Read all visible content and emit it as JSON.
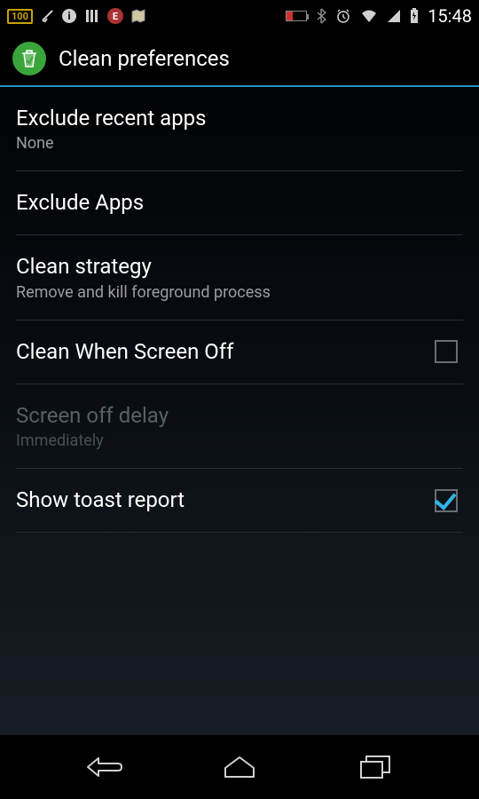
{
  "status_bar": {
    "battery_pct": "100",
    "time": "15:48"
  },
  "app_bar": {
    "title": "Clean preferences"
  },
  "settings": [
    {
      "title": "Exclude recent apps",
      "subtitle": "None",
      "has_checkbox": false,
      "disabled": false
    },
    {
      "title": "Exclude Apps",
      "subtitle": null,
      "has_checkbox": false,
      "disabled": false
    },
    {
      "title": "Clean strategy",
      "subtitle": "Remove and kill foreground process",
      "has_checkbox": false,
      "disabled": false
    },
    {
      "title": "Clean When Screen Off",
      "subtitle": null,
      "has_checkbox": true,
      "checked": false,
      "disabled": false
    },
    {
      "title": "Screen off delay",
      "subtitle": "Immediately",
      "has_checkbox": false,
      "disabled": true
    },
    {
      "title": "Show toast report",
      "subtitle": null,
      "has_checkbox": true,
      "checked": true,
      "disabled": false
    }
  ]
}
